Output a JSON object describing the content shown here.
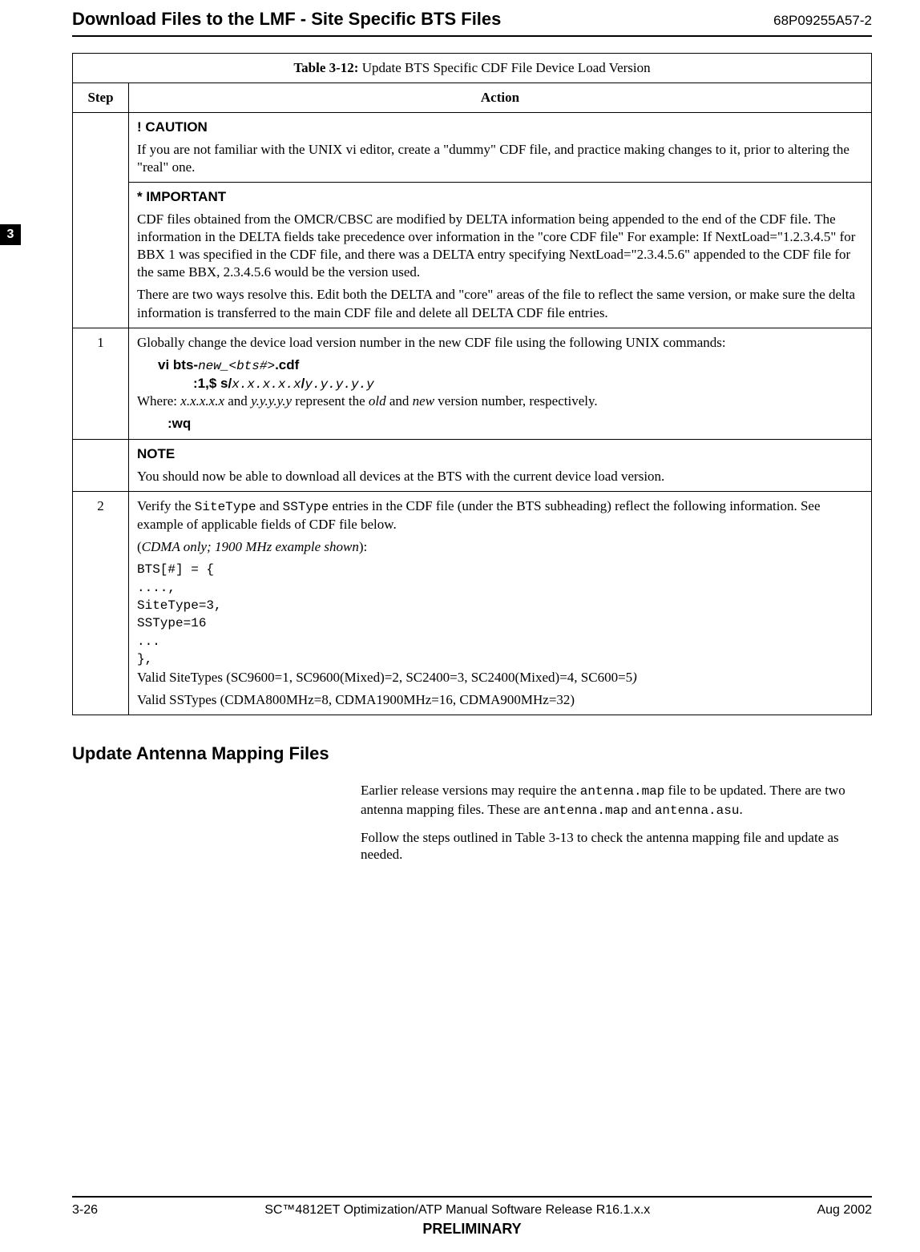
{
  "header": {
    "left": "Download Files to the LMF - Site Specific BTS Files",
    "right": "68P09255A57-2"
  },
  "side_tab": "3",
  "table": {
    "title_prefix": "Table 3-12: ",
    "title_rest": "Update BTS Specific CDF File Device Load Version",
    "col_step": "Step",
    "col_action": "Action",
    "caution_head": "! CAUTION",
    "caution_body": "If you are not familiar with the UNIX vi editor, create a \"dummy\" CDF file, and practice making changes to it, prior to altering the \"real\" one.",
    "important_head": "* IMPORTANT",
    "important_p1": "CDF files obtained from the OMCR/CBSC are modified by DELTA information being appended to the end of the CDF file. The information in the DELTA fields take precedence over information in the \"core CDF file\" For example: If NextLoad=\"1.2.3.4.5\" for BBX 1 was specified in the CDF file, and there was a DELTA entry specifying NextLoad=\"2.3.4.5.6\" appended to the CDF file for the same BBX, 2.3.4.5.6 would be the version used.",
    "important_p2": "There are two ways resolve this. Edit both the DELTA and \"core\" areas of the file to reflect the same version, or make sure the delta information is transferred to the main CDF file and delete all DELTA CDF file entries.",
    "step1_num": "1",
    "step1_intro": "Globally change the device load version number in the new CDF file using the following UNIX commands:",
    "step1_cmd1_a": "vi  bts-",
    "step1_cmd1_b": "new_<bts#>",
    "step1_cmd1_c": ".cdf",
    "step1_cmd2_a": ":1,$   s/",
    "step1_cmd2_b": "x.x.x.x.x",
    "step1_cmd2_c": "/",
    "step1_cmd2_d": "y.y.y.y.y",
    "step1_where_a": "Where: ",
    "step1_where_b": "x.x.x.x.x",
    "step1_where_c": " and ",
    "step1_where_d": "y.y.y.y.y",
    "step1_where_e": " represent the ",
    "step1_where_f": "old",
    "step1_where_g": " and ",
    "step1_where_h": "new",
    "step1_where_i": " version number, respectively.",
    "step1_wq": ":wq",
    "note_head": "NOTE",
    "note_body": "You should now be able to download all devices at the BTS with the current device load version.",
    "step2_num": "2",
    "step2_p1_a": "Verify the ",
    "step2_p1_b": "SiteType",
    "step2_p1_c": " and ",
    "step2_p1_d": "SSType",
    "step2_p1_e": " entries in the CDF file (under the BTS subheading) reflect the following information. See example of applicable fields of CDF file below.",
    "step2_p2_a": "(",
    "step2_p2_b": "CDMA only; 1900 MHz example shown",
    "step2_p2_c": "):",
    "code1": "BTS[#] = {",
    "code2": "....,",
    "code3": "SiteType=3,",
    "code4": "SSType=16",
    "code5": "...",
    "code6": "},",
    "valid1_a": "Valid SiteTypes (SC9600=1, SC9600(Mixed)=2, SC2400=3, SC2400(Mixed)=4, SC600=5",
    "valid1_b": ")",
    "valid2": "Valid SSTypes   (CDMA800MHz=8,   CDMA1900MHz=16,        CDMA900MHz=32)"
  },
  "section": {
    "heading": "Update Antenna Mapping Files",
    "p1_a": "Earlier release versions may require the ",
    "p1_b": "antenna.map",
    "p1_c": " file to be updated. There are two antenna mapping files. These are ",
    "p1_d": "antenna.map",
    "p1_e": " and ",
    "p1_f": "antenna.asu",
    "p1_g": ".",
    "p2": "Follow the steps outlined in Table 3-13 to check the antenna mapping file and update as needed."
  },
  "footer": {
    "left": "3-26",
    "center": "SC™4812ET Optimization/ATP Manual Software Release R16.1.x.x",
    "right": "Aug 2002",
    "prelim": "PRELIMINARY"
  }
}
